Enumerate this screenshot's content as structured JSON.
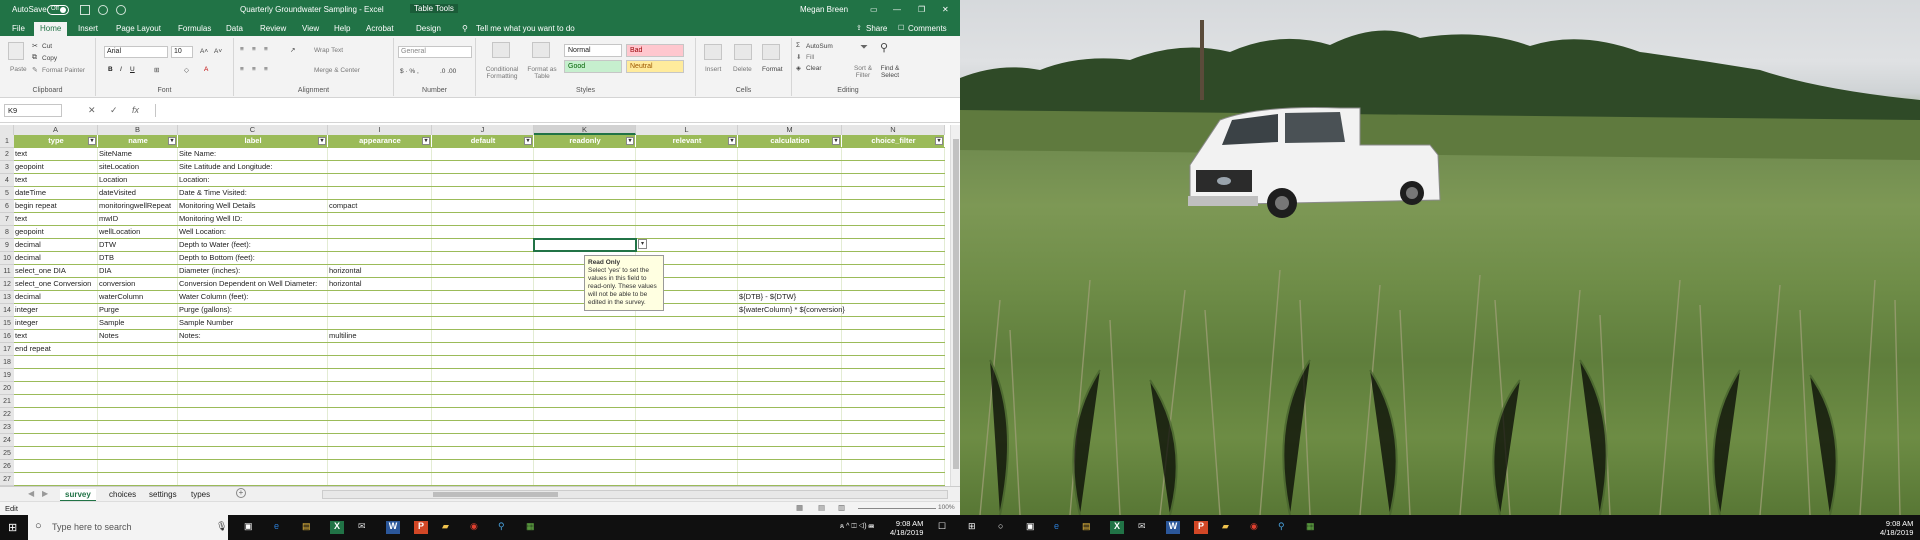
{
  "window": {
    "autosave_label": "AutoSave",
    "autosave_state": "Off",
    "title": "Quarterly Groundwater Sampling  -  Excel",
    "context_tab": "Table Tools",
    "user": "Megan Breen"
  },
  "menu": {
    "tabs": [
      "File",
      "Home",
      "Insert",
      "Page Layout",
      "Formulas",
      "Data",
      "Review",
      "View",
      "Help",
      "Acrobat",
      "Design"
    ],
    "tell_me": "Tell me what you want to do",
    "share": "Share",
    "comments": "Comments"
  },
  "ribbon": {
    "clipboard": {
      "paste": "Paste",
      "cut": "Cut",
      "copy": "Copy",
      "painter": "Format Painter",
      "label": "Clipboard"
    },
    "font": {
      "name": "Arial",
      "size": "10",
      "label": "Font"
    },
    "alignment": {
      "wrap": "Wrap Text",
      "merge": "Merge & Center",
      "label": "Alignment"
    },
    "number": {
      "format": "General",
      "label": "Number"
    },
    "styles": {
      "cond": "Conditional Formatting",
      "table": "Format as Table",
      "items": [
        "Normal",
        "Bad",
        "Good",
        "Neutral"
      ],
      "label": "Styles"
    },
    "cells": {
      "insert": "Insert",
      "delete": "Delete",
      "format": "Format",
      "label": "Cells"
    },
    "editing": {
      "autosum": "AutoSum",
      "fill": "Fill",
      "clear": "Clear",
      "sort": "Sort & Filter",
      "find": "Find & Select",
      "label": "Editing"
    }
  },
  "formula": {
    "namebox": "K9",
    "fx": "fx",
    "value": ""
  },
  "grid": {
    "columns": [
      {
        "letter": "A",
        "header": "type"
      },
      {
        "letter": "B",
        "header": "name"
      },
      {
        "letter": "C",
        "header": "label"
      },
      {
        "letter": "I",
        "header": "appearance"
      },
      {
        "letter": "J",
        "header": "default"
      },
      {
        "letter": "K",
        "header": "readonly"
      },
      {
        "letter": "L",
        "header": "relevant"
      },
      {
        "letter": "M",
        "header": "calculation"
      },
      {
        "letter": "N",
        "header": "choice_filter"
      }
    ],
    "rows": [
      [
        "text",
        "SiteName",
        "Site Name:",
        "",
        "",
        "",
        "",
        "",
        ""
      ],
      [
        "geopoint",
        "siteLocation",
        "Site Latitude and Longitude:",
        "",
        "",
        "",
        "",
        "",
        ""
      ],
      [
        "text",
        "Location",
        "Location:",
        "",
        "",
        "",
        "",
        "",
        ""
      ],
      [
        "dateTime",
        "dateVisited",
        "Date & Time Visited:",
        "",
        "",
        "",
        "",
        "",
        ""
      ],
      [
        "begin repeat",
        "monitoringwellRepeat",
        "Monitoring Well Details",
        "compact",
        "",
        "",
        "",
        "",
        ""
      ],
      [
        "text",
        "mwID",
        "Monitoring Well ID:",
        "",
        "",
        "",
        "",
        "",
        ""
      ],
      [
        "geopoint",
        "wellLocation",
        "Well Location:",
        "",
        "",
        "",
        "",
        "",
        ""
      ],
      [
        "decimal",
        "DTW",
        "Depth to Water (feet):",
        "",
        "",
        "",
        "",
        "",
        ""
      ],
      [
        "decimal",
        "DTB",
        "Depth to Bottom (feet):",
        "",
        "",
        "",
        "",
        "",
        ""
      ],
      [
        "select_one DIA",
        "DIA",
        "Diameter (inches):",
        "horizontal",
        "",
        "",
        "",
        "",
        ""
      ],
      [
        "select_one Conversion",
        "conversion",
        "Conversion Dependent on Well Diameter:",
        "horizontal",
        "",
        "",
        "",
        "",
        ""
      ],
      [
        "decimal",
        "waterColumn",
        "Water Column (feet):",
        "",
        "",
        "",
        "",
        "${DTB} - ${DTW}",
        ""
      ],
      [
        "integer",
        "Purge",
        "Purge (gallons):",
        "",
        "",
        "",
        "",
        "${waterColumn} * ${conversion}",
        ""
      ],
      [
        "integer",
        "Sample",
        "Sample Number",
        "",
        "",
        "",
        "",
        "",
        ""
      ],
      [
        "text",
        "Notes",
        "Notes:",
        "multiline",
        "",
        "",
        "",
        "",
        ""
      ],
      [
        "end repeat",
        "",
        "",
        "",
        "",
        "",
        "",
        "",
        ""
      ],
      [
        "",
        "",
        "",
        "",
        "",
        "",
        "",
        "",
        ""
      ],
      [
        "",
        "",
        "",
        "",
        "",
        "",
        "",
        "",
        ""
      ],
      [
        "",
        "",
        "",
        "",
        "",
        "",
        "",
        "",
        ""
      ],
      [
        "",
        "",
        "",
        "",
        "",
        "",
        "",
        "",
        ""
      ],
      [
        "",
        "",
        "",
        "",
        "",
        "",
        "",
        "",
        ""
      ],
      [
        "",
        "",
        "",
        "",
        "",
        "",
        "",
        "",
        ""
      ],
      [
        "",
        "",
        "",
        "",
        "",
        "",
        "",
        "",
        ""
      ],
      [
        "",
        "",
        "",
        "",
        "",
        "",
        "",
        "",
        ""
      ],
      [
        "",
        "",
        "",
        "",
        "",
        "",
        "",
        "",
        ""
      ]
    ],
    "row_numbers": [
      "1",
      "2",
      "3",
      "4",
      "5",
      "6",
      "7",
      "8",
      "9",
      "10",
      "11",
      "12",
      "13",
      "14",
      "15",
      "16",
      "17",
      "18",
      "19",
      "20",
      "21",
      "22",
      "23",
      "24",
      "25",
      "26",
      "27"
    ],
    "tooltip_title": "Read Only",
    "tooltip_body": "Select 'yes' to set the values in this field to read-only. These values will not be able to be edited in the survey."
  },
  "sheets": [
    "survey",
    "choices",
    "settings",
    "types"
  ],
  "status": {
    "mode": "Edit",
    "zoom": "100%"
  },
  "taskbar": {
    "search_placeholder": "Type here to search",
    "time": "9:08 AM",
    "date": "4/18/2019"
  },
  "colors": {
    "excel_green": "#217346",
    "table_header": "#9bbb59"
  }
}
